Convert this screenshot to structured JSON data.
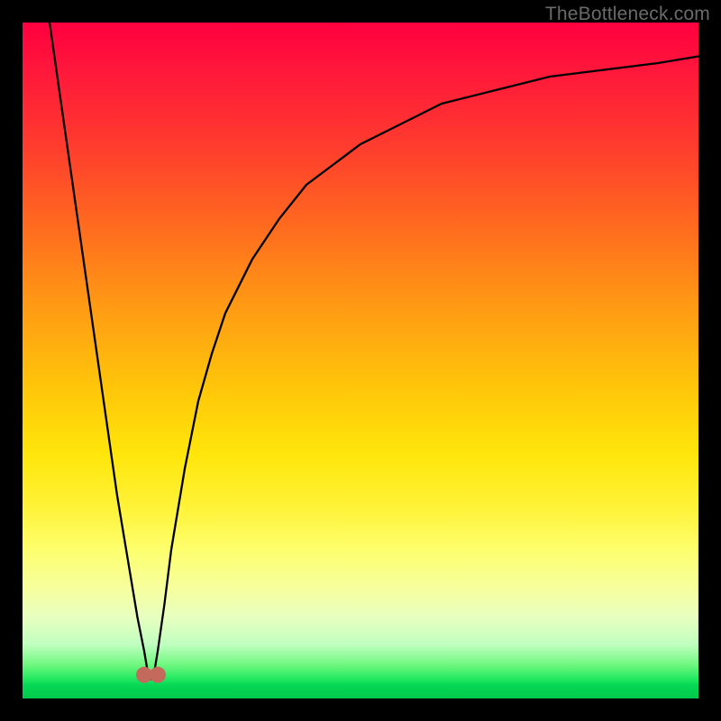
{
  "watermark": "TheBottleneck.com",
  "chart_data": {
    "type": "line",
    "title": "",
    "xlabel": "",
    "ylabel": "",
    "xlim": [
      0,
      100
    ],
    "ylim": [
      0,
      100
    ],
    "grid": false,
    "legend": false,
    "series": [
      {
        "name": "bottleneck-curve",
        "x": [
          4,
          6,
          8,
          10,
          12,
          14,
          16,
          17,
          18,
          18.5,
          19,
          19.5,
          20,
          21,
          22,
          24,
          26,
          28,
          30,
          34,
          38,
          42,
          46,
          50,
          56,
          62,
          70,
          78,
          86,
          94,
          100
        ],
        "y": [
          100,
          86,
          72,
          58,
          44,
          30,
          18,
          12,
          7,
          4,
          3,
          4,
          7,
          14,
          22,
          34,
          44,
          51,
          57,
          65,
          71,
          76,
          79,
          82,
          85,
          88,
          90,
          92,
          93,
          94,
          95
        ]
      }
    ],
    "markers": [
      {
        "name": "marker-left",
        "x": 18.0,
        "y": 3.5
      },
      {
        "name": "marker-right",
        "x": 20.0,
        "y": 3.5
      }
    ],
    "background_gradient": {
      "top": "#ff0040",
      "upper_mid": "#ffa012",
      "mid": "#ffe60b",
      "lower_mid": "#f6ffa0",
      "bottom": "#00c84c"
    }
  }
}
